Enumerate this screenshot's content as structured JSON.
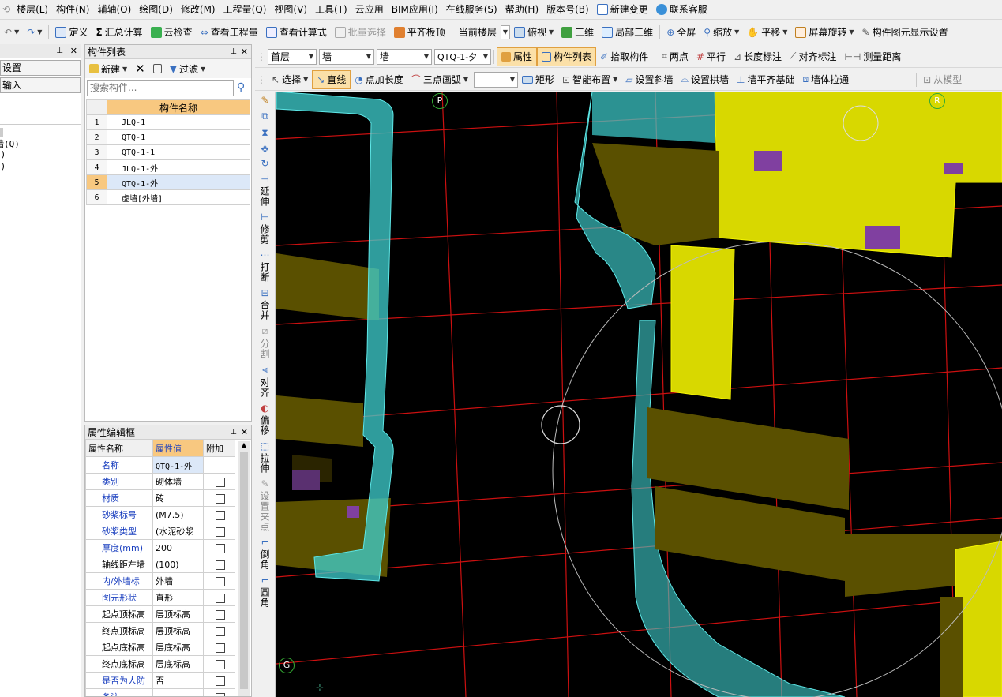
{
  "menu": [
    "楼层(L)",
    "构件(N)",
    "辅轴(O)",
    "绘图(D)",
    "修改(M)",
    "工程量(Q)",
    "视图(V)",
    "工具(T)",
    "云应用",
    "BIM应用(I)",
    "在线服务(S)",
    "帮助(H)",
    "版本号(B)",
    "新建变更",
    "联系客服"
  ],
  "toolbar1": [
    "定义",
    "汇总计算",
    "云检查",
    "查看工程量",
    "查看计算式",
    "批量选择",
    "平齐板顶",
    "当前楼层",
    "俯视",
    "三维",
    "局部三维",
    "全屏",
    "缩放",
    "平移",
    "屏幕旋转",
    "构件图元显示设置"
  ],
  "toolbar2": {
    "floor": "首层",
    "type1": "墙",
    "type2": "墙",
    "component": "QTQ-1-夕",
    "buttons": [
      "属性",
      "构件列表",
      "拾取构件",
      "两点",
      "平行",
      "长度标注",
      "对齐标注",
      "测量距离"
    ]
  },
  "toolbar3": [
    "选择",
    "直线",
    "点加长度",
    "三点画弧",
    "矩形",
    "智能布置",
    "设置斜墙",
    "设置拱墙",
    "墙平齐基础",
    "墙体拉通",
    "从模型"
  ],
  "left_nav": {
    "items": [
      "设置",
      "输入"
    ],
    "sub": [
      "墙(Q)",
      "E)",
      "Q)"
    ]
  },
  "comp_list": {
    "title": "构件列表",
    "new_label": "新建",
    "filter_label": "过滤",
    "search_placeholder": "搜索构件...",
    "header": "构件名称",
    "rows": [
      {
        "n": "1",
        "name": "JLQ-1"
      },
      {
        "n": "2",
        "name": "QTQ-1"
      },
      {
        "n": "3",
        "name": "QTQ-1-1"
      },
      {
        "n": "4",
        "name": "JLQ-1-外"
      },
      {
        "n": "5",
        "name": "QTQ-1-外"
      },
      {
        "n": "6",
        "name": "虚墙[外墙]"
      }
    ]
  },
  "props": {
    "title": "属性编辑框",
    "headers": [
      "属性名称",
      "属性值",
      "附加"
    ],
    "rows": [
      {
        "k": "名称",
        "v": "QTQ-1-外",
        "cb": false
      },
      {
        "k": "类别",
        "v": "砌体墙",
        "cb": true
      },
      {
        "k": "材质",
        "v": "砖",
        "cb": true
      },
      {
        "k": "砂浆标号",
        "v": "(M7.5)",
        "cb": true
      },
      {
        "k": "砂浆类型",
        "v": "(水泥砂浆",
        "cb": true
      },
      {
        "k": "厚度(mm)",
        "v": "200",
        "cb": true
      },
      {
        "k": "轴线距左墙",
        "v": "(100)",
        "cb": true
      },
      {
        "k": "内/外墙标",
        "v": "外墙",
        "cb": true
      },
      {
        "k": "图元形状",
        "v": "直形",
        "cb": true
      },
      {
        "k": "起点顶标高",
        "v": "层顶标高",
        "cb": true
      },
      {
        "k": "终点顶标高",
        "v": "层顶标高",
        "cb": true
      },
      {
        "k": "起点底标高",
        "v": "层底标高",
        "cb": true
      },
      {
        "k": "终点底标高",
        "v": "层底标高",
        "cb": true
      },
      {
        "k": "是否为人防",
        "v": "否",
        "cb": true
      },
      {
        "k": "备注",
        "v": "",
        "cb": true
      }
    ]
  },
  "vtools": [
    "延伸",
    "修剪",
    "打断",
    "合并",
    "分割",
    "对齐",
    "偏移",
    "拉伸",
    "设置夹点",
    "倒角",
    "圆角"
  ],
  "axis_labels": [
    "P",
    "R",
    "G"
  ],
  "colors": {
    "canvas": "#000000",
    "wall_cyan": "#3fd0d0",
    "wall_olive": "#5a5000",
    "wall_yellow": "#d8d800",
    "grid": "#cc1010",
    "purple": "#8040a0"
  }
}
